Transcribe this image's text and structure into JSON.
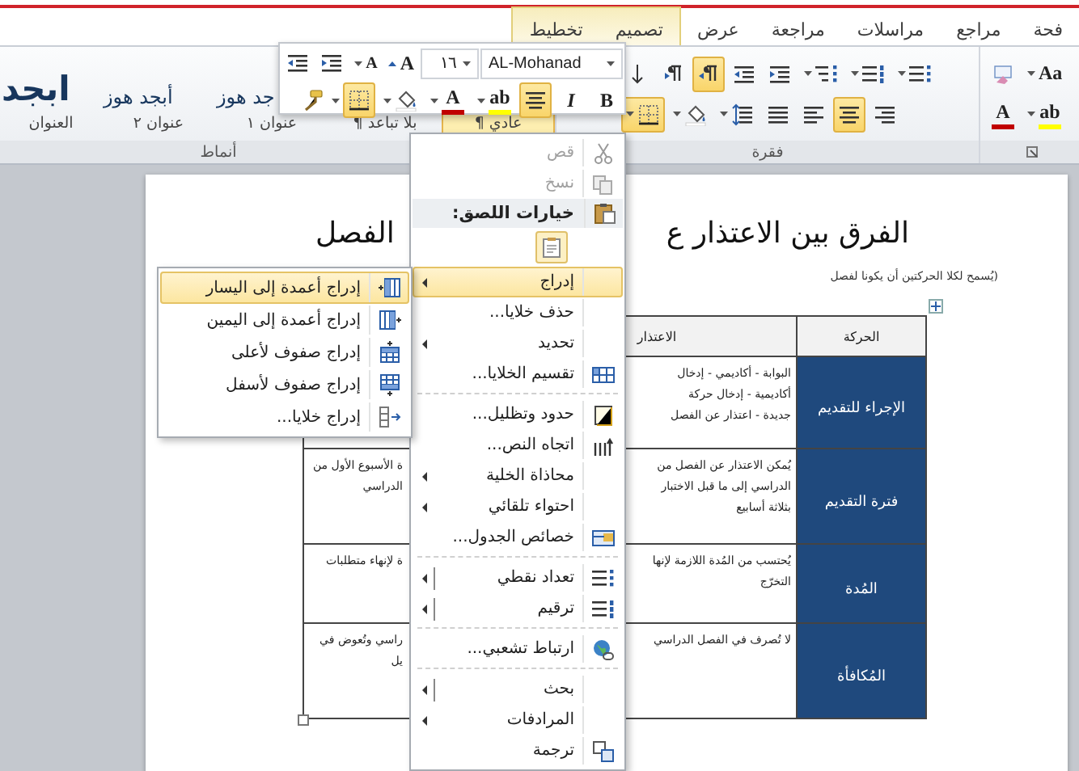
{
  "ribbon": {
    "tabs": [
      {
        "label": "فحة",
        "contextual": false
      },
      {
        "label": "مراجع",
        "contextual": false
      },
      {
        "label": "مراسلات",
        "contextual": false
      },
      {
        "label": "مراجعة",
        "contextual": false
      },
      {
        "label": "عرض",
        "contextual": false
      },
      {
        "label": "تصميم",
        "contextual": true
      },
      {
        "label": "تخطيط",
        "contextual": true
      }
    ],
    "styles": {
      "label": "أنماط",
      "items": [
        {
          "label": "¶ عادي",
          "selected": true
        },
        {
          "label": "¶ بلا تباعد",
          "selected": false
        },
        {
          "preview": "جد هوز",
          "label": "عنوان ١",
          "selected": false
        },
        {
          "preview": "أبجد هوز",
          "label": "عنوان ٢",
          "selected": false
        },
        {
          "preview": "ابجد",
          "label": "العنوان",
          "selected": false
        }
      ]
    },
    "paragraph": {
      "label": "فقرة",
      "rtl": true,
      "align_center": true,
      "borders_on": true
    },
    "font": {
      "change_case": "Aa",
      "font_color": {
        "label": "A",
        "color": "#c00000"
      },
      "highlight": {
        "label": "ab",
        "color": "#ffff00"
      }
    }
  },
  "mini_toolbar": {
    "font": "AL-Mohanad",
    "size": "١٦",
    "grow": "A",
    "shrink": "A",
    "bold": "B",
    "italic": "I",
    "align_center": true,
    "highlight": {
      "label": "ab",
      "color": "#ffff00"
    },
    "font_color": {
      "label": "A",
      "color": "#c00000"
    },
    "borders_on": true
  },
  "document": {
    "title_right": "الفرق بين الاعتذار ع",
    "title_left": "الفصل",
    "subtitle": "(يُسمح لكلا الحركتين أن يكونا لفصل",
    "table": {
      "columns": [
        {
          "label": "الحركة"
        },
        {
          "label": "الاعتذار"
        }
      ],
      "rows": [
        {
          "movement": "الإجراء للتقديم",
          "excuse": [
            "البوابة - أكاديمي - إدخال",
            "أكاديمية - إدخال حركة",
            "جديدة - اعتذار عن الفصل"
          ]
        },
        {
          "movement": "فترة التقديم",
          "excuse": [
            "يُمكن الاعتذار عن الفصل من",
            "الدراسي إلى ما قبل الاختبار",
            "بثلاثة أسابيع"
          ],
          "column_3": [
            "ة الأسبوع الأول من",
            "الدراسي"
          ]
        },
        {
          "movement": "المُدة",
          "excuse": [
            "يُحتسب من المُدة اللازمة لإنها",
            "التخرّج"
          ],
          "column_3": [
            "ة لإنهاء متطلبات"
          ]
        },
        {
          "movement": "المُكافأة",
          "excuse": [
            "لا تُصرف في الفصل الدراسي"
          ],
          "column_3": [
            "راسي وتُعوض في",
            "يل"
          ]
        }
      ]
    }
  },
  "context_menu": {
    "items": [
      {
        "kind": "item",
        "label": "قص",
        "disabled": true,
        "selected": false,
        "submenu": false,
        "split": false
      },
      {
        "kind": "item",
        "label": "نسخ",
        "disabled": true,
        "selected": false,
        "submenu": false,
        "split": false
      },
      {
        "kind": "header",
        "label": "خيارات اللصق:"
      },
      {
        "kind": "paste"
      },
      {
        "kind": "item",
        "label": "إدراج",
        "disabled": false,
        "selected": true,
        "submenu": true,
        "split": false
      },
      {
        "kind": "item",
        "label": "حذف خلايا...",
        "disabled": false,
        "selected": false,
        "submenu": false,
        "split": false
      },
      {
        "kind": "item",
        "label": "تحديد",
        "disabled": false,
        "selected": false,
        "submenu": true,
        "split": false
      },
      {
        "kind": "item",
        "label": "تقسيم الخلايا...",
        "disabled": false,
        "selected": false,
        "submenu": false,
        "split": false
      },
      {
        "kind": "separator"
      },
      {
        "kind": "item",
        "label": "حدود وتظليل...",
        "disabled": false,
        "selected": false,
        "submenu": false,
        "split": false
      },
      {
        "kind": "item",
        "label": "اتجاه النص...",
        "disabled": false,
        "selected": false,
        "submenu": false,
        "split": false
      },
      {
        "kind": "item",
        "label": "محاذاة الخلية",
        "disabled": false,
        "selected": false,
        "submenu": true,
        "split": false
      },
      {
        "kind": "item",
        "label": "احتواء تلقائي",
        "disabled": false,
        "selected": false,
        "submenu": true,
        "split": false
      },
      {
        "kind": "item",
        "label": "خصائص الجدول...",
        "disabled": false,
        "selected": false,
        "submenu": false,
        "split": false
      },
      {
        "kind": "separator"
      },
      {
        "kind": "item",
        "label": "تعداد نقطي",
        "disabled": false,
        "selected": false,
        "submenu": true,
        "split": true
      },
      {
        "kind": "item",
        "label": "ترقيم",
        "disabled": false,
        "selected": false,
        "submenu": true,
        "split": true
      },
      {
        "kind": "separator"
      },
      {
        "kind": "item",
        "label": "ارتباط تشعبي...",
        "disabled": false,
        "selected": false,
        "submenu": false,
        "split": false
      },
      {
        "kind": "separator"
      },
      {
        "kind": "item",
        "label": "بحث",
        "disabled": false,
        "selected": false,
        "submenu": true,
        "split": true
      },
      {
        "kind": "item",
        "label": "المرادفات",
        "disabled": false,
        "selected": false,
        "submenu": true,
        "split": false
      },
      {
        "kind": "item",
        "label": "ترجمة",
        "disabled": false,
        "selected": false,
        "submenu": false,
        "split": false
      }
    ]
  },
  "submenu": {
    "items": [
      {
        "label": "إدراج أعمدة إلى اليسار",
        "selected": true
      },
      {
        "label": "إدراج أعمدة إلى اليمين",
        "selected": false
      },
      {
        "label": "إدراج صفوف لأعلى",
        "selected": false
      },
      {
        "label": "إدراج صفوف لأسفل",
        "selected": false
      },
      {
        "label": "إدراج خلايا...",
        "selected": false
      }
    ]
  }
}
